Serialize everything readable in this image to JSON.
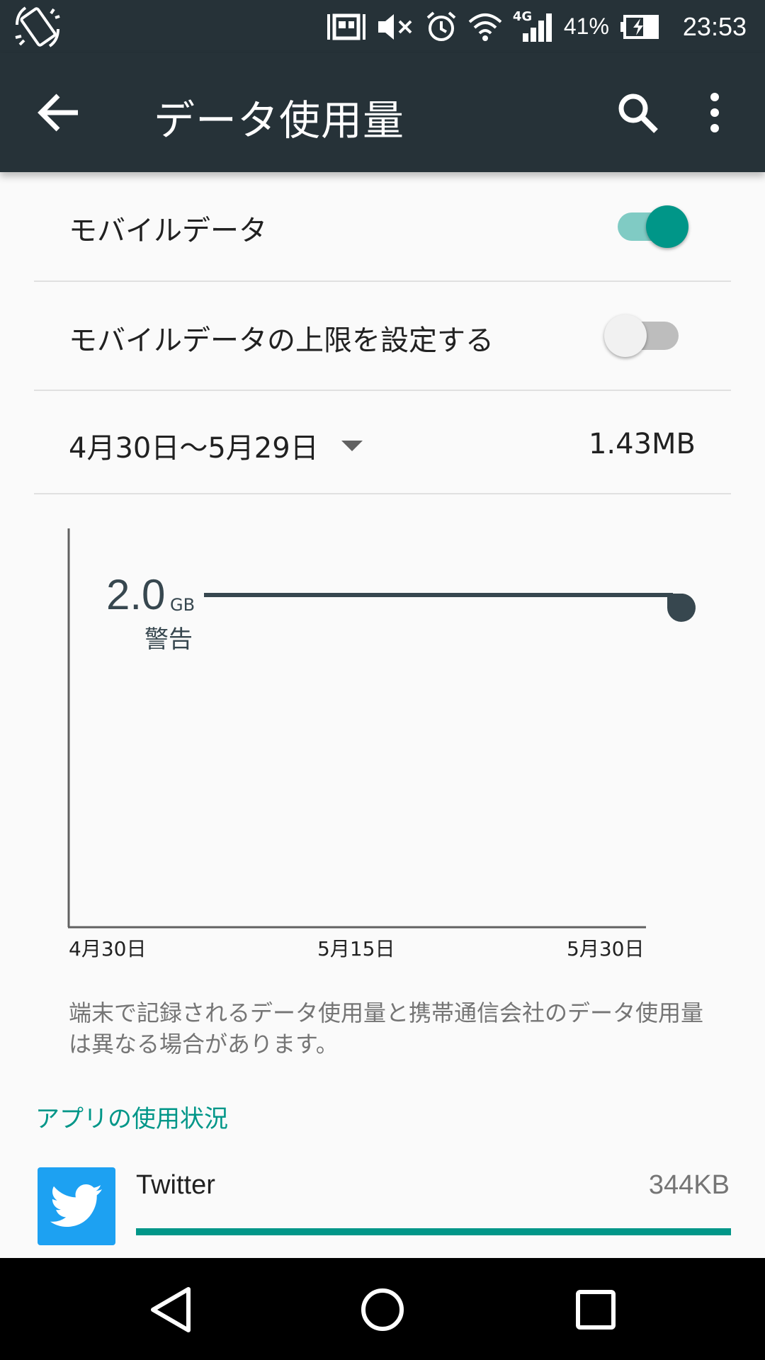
{
  "colors": {
    "toolbar": "#263238",
    "accent": "#009688",
    "accent_light": "#80cbc4",
    "chart_line": "#37474f",
    "twitter": "#1da1f2"
  },
  "status_bar": {
    "battery": "41%",
    "time": "23:53",
    "network": "4G",
    "icons": [
      "screen-rotation-icon",
      "vibrate-icon",
      "mute-icon",
      "alarm-icon",
      "wifi-icon",
      "signal-icon",
      "battery-charging-icon"
    ]
  },
  "toolbar": {
    "title": "データ使用量",
    "icons": [
      "back-arrow-icon",
      "search-icon",
      "more-vert-icon"
    ]
  },
  "settings": {
    "mobile_data": {
      "label": "モバイルデータ",
      "enabled": true
    },
    "data_limit": {
      "label": "モバイルデータの上限を設定する",
      "enabled": false
    }
  },
  "cycle": {
    "range": "4月30日〜5月29日",
    "total": "1.43MB"
  },
  "chart_data": {
    "type": "line",
    "warning": {
      "value": "2.0",
      "unit": "GB",
      "label": "警告"
    },
    "x_ticks": [
      "4月30日",
      "5月15日",
      "5月30日"
    ]
  },
  "disclaimer": "端末で記録されるデータ使用量と携帯通信会社のデータ使用量は異なる場合があります。",
  "section": {
    "app_usage": "アプリの使用状況"
  },
  "apps": [
    {
      "name": "Twitter",
      "usage": "344KB",
      "fraction": 1.0,
      "icon": "twitter-icon"
    }
  ],
  "nav_bar": {
    "icons": [
      "back-nav-icon",
      "home-nav-icon",
      "recents-nav-icon"
    ]
  }
}
